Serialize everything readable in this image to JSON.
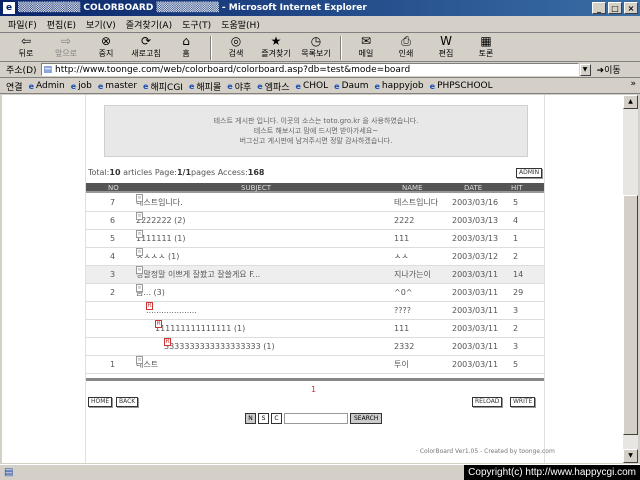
{
  "window": {
    "title": "▒▒▒▒▒▒▒▒▒ COLORBOARD ▒▒▒▒▒▒▒▒▒ - Microsoft Internet Explorer",
    "buttons": [
      "_",
      "□",
      "×"
    ]
  },
  "menubar": {
    "items": [
      "파일(F)",
      "편집(E)",
      "보기(V)",
      "즐겨찾기(A)",
      "도구(T)",
      "도움말(H)"
    ]
  },
  "toolbar": {
    "buttons": [
      {
        "label": "뒤로",
        "icon": "back-arrow-icon"
      },
      {
        "label": "앞으로",
        "icon": "forward-arrow-icon"
      },
      {
        "label": "중지",
        "icon": "stop-icon"
      },
      {
        "label": "새로고침",
        "icon": "refresh-icon"
      },
      {
        "label": "홈",
        "icon": "home-icon"
      },
      {
        "label": "검색",
        "icon": "search-icon"
      },
      {
        "label": "즐겨찾기",
        "icon": "favorites-icon"
      },
      {
        "label": "목록보기",
        "icon": "history-icon"
      },
      {
        "label": "메일",
        "icon": "mail-icon"
      },
      {
        "label": "인쇄",
        "icon": "print-icon"
      },
      {
        "label": "편집",
        "icon": "edit-icon"
      },
      {
        "label": "토론",
        "icon": "discuss-icon"
      }
    ]
  },
  "address": {
    "label": "주소(D)",
    "url": "http://www.toonge.com/web/colorboard/colorboard.asp?db=test&mode=board",
    "go_label": "이동"
  },
  "links": {
    "label": "연결",
    "items": [
      "Admin",
      "job",
      "master",
      "해피CGI",
      "해피몰",
      "야후",
      "엠파스",
      "CHOL",
      "Daum",
      "happyjob",
      "PHPSCHOOL"
    ],
    "more": "»"
  },
  "board": {
    "notice_lines": [
      "테스트 게시판 입니다. 이곳의 소스는 toto.gro.kr 을 사용하였습니다.",
      "테스트 해보시고 맘에 드시면 받아가세요~",
      "버그신고 게시판에 남겨주시면 정말 감사하겠습니다."
    ],
    "stats": {
      "total_label": "Total:",
      "total": "10",
      "articles_label": " articles Page:",
      "page": "1/1",
      "pages_label": "pages Access:",
      "access": "168"
    },
    "admin_label": "ADMIN",
    "columns": {
      "no": "NO",
      "subject": "SUBJECT",
      "name": "NAME",
      "date": "DATE",
      "hit": "HIT"
    },
    "rows": [
      {
        "no": "7",
        "subject": "테스트입니다.",
        "name": "테스트입니다",
        "date": "2003/03/16",
        "hit": "5",
        "depth": 0,
        "hl": false
      },
      {
        "no": "6",
        "subject": "2222222 (2)",
        "name": "2222",
        "date": "2003/03/13",
        "hit": "4",
        "depth": 0,
        "hl": false
      },
      {
        "no": "5",
        "subject": "1111111 (1)",
        "name": "111",
        "date": "2003/03/13",
        "hit": "1",
        "depth": 0,
        "hl": false
      },
      {
        "no": "4",
        "subject": "ㅅㅅㅅㅅ (1)",
        "name": "ㅅㅅ",
        "date": "2003/03/12",
        "hit": "2",
        "depth": 0,
        "hl": false
      },
      {
        "no": "3",
        "subject": "정말정말 이쁘게 잘봤고 잘쓸게요 F...",
        "name": "지나가는이",
        "date": "2003/03/11",
        "hit": "14",
        "depth": 0,
        "hl": true
      },
      {
        "no": "2",
        "subject": "음... (3)",
        "name": "^0^",
        "date": "2003/03/11",
        "hit": "29",
        "depth": 0,
        "hl": false
      },
      {
        "no": "",
        "subject": "....................",
        "name": "????",
        "date": "2003/03/11",
        "hit": "3",
        "depth": 1,
        "hl": false
      },
      {
        "no": "",
        "subject": "111111111111111 (1)",
        "name": "111",
        "date": "2003/03/11",
        "hit": "2",
        "depth": 2,
        "hl": false
      },
      {
        "no": "",
        "subject": "3333333333333333333 (1)",
        "name": "2332",
        "date": "2003/03/11",
        "hit": "3",
        "depth": 3,
        "hl": false
      },
      {
        "no": "1",
        "subject": "테스트",
        "name": "투이",
        "date": "2003/03/11",
        "hit": "5",
        "depth": 0,
        "hl": false
      }
    ],
    "page_number": "1",
    "home_label": "HOME",
    "back_label": "BACK",
    "reload_label": "RELOAD",
    "write_label": "WRITE",
    "search_opts": [
      "N",
      "S",
      "C"
    ],
    "search_label": "SEARCH",
    "credit": "· ColorBoard Ver1.05 - Created by toonge.com"
  },
  "status": {
    "copyright": "Copyright(c) http://www.happycgi.com"
  }
}
